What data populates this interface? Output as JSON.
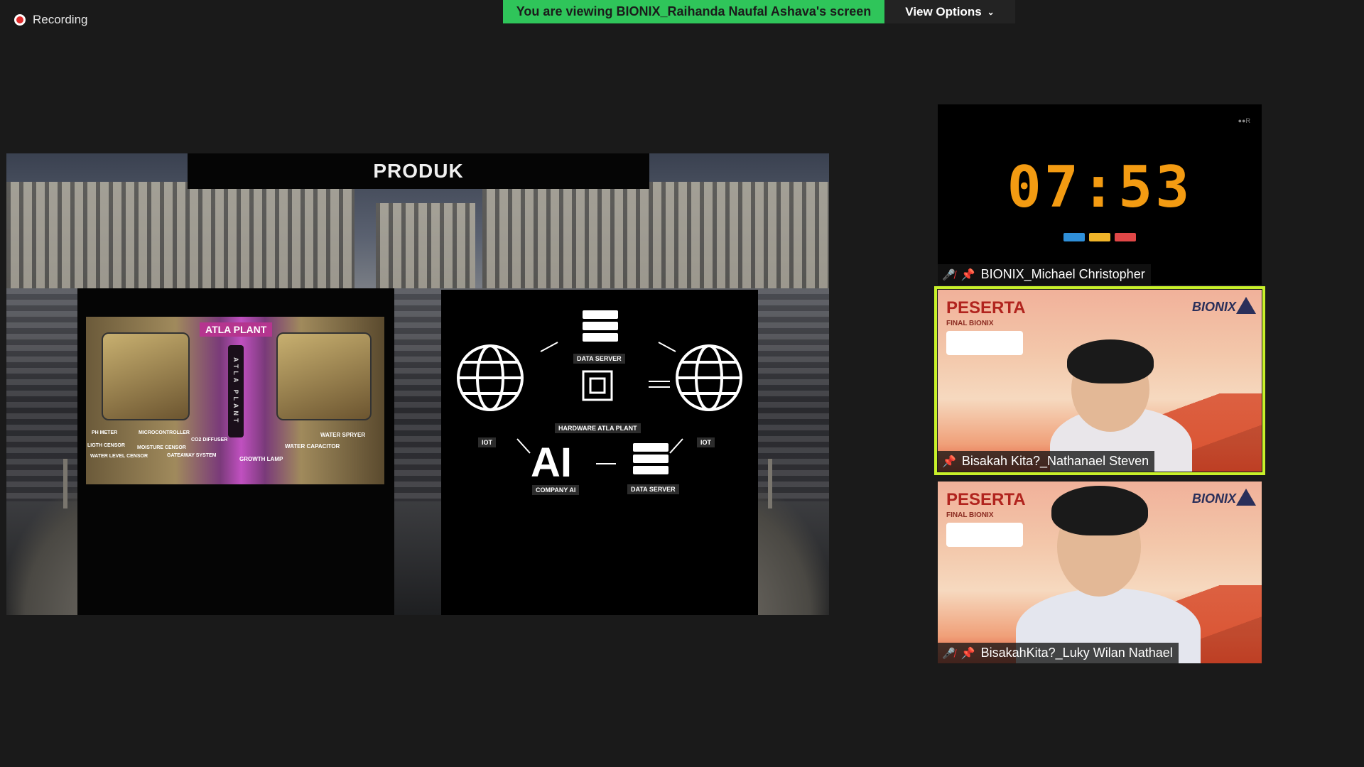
{
  "top_bar": {
    "recording_label": "Recording",
    "banner_text": "You are viewing BIONIX_Raihanda Naufal Ashava's screen",
    "view_options_label": "View Options",
    "banner_color": "#2fc55a"
  },
  "slide": {
    "title": "PRODUK",
    "left_panel": {
      "badge": "ATLA PLANT",
      "pillar_text": "ATLA PLANT",
      "labels": {
        "ph_meter": "PH METER",
        "light_censor": "LIGTH CENSOR",
        "water_level": "WATER LEVEL CENSOR",
        "moisture": "MOISTURE CENSOR",
        "microcontroller": "MICROCONTROLLER",
        "co2": "CO2 DIFFUSER",
        "gateway": "GATEAWAY SYSTEM",
        "growth_lamp": "GROWTH LAMP",
        "water_capacitor": "WATER CAPACITOR",
        "water_sprayer": "WATER SPRYER"
      }
    },
    "right_panel": {
      "ai_text": "AI",
      "labels": {
        "data_server_top": "DATA SERVER",
        "hardware": "HARDWARE ATLA PLANT",
        "iot_left": "IOT",
        "iot_right": "IOT",
        "company_ai": "COMPANY AI",
        "data_server_bottom": "DATA SERVER"
      }
    }
  },
  "participants": {
    "timer": {
      "display": "07:53",
      "corner": "●●R",
      "name": "BIONIX_Michael Christopher",
      "button_colors": [
        "#2f8fd8",
        "#f0b429",
        "#e04747"
      ]
    },
    "p1": {
      "banner_title": "PESERTA",
      "banner_sub": "FINAL BIONIX",
      "logo": "BIONIX",
      "name": "Bisakah Kita?_Nathanael Steven",
      "highlight_color": "#c8f02a"
    },
    "p2": {
      "banner_title": "PESERTA",
      "banner_sub": "FINAL BIONIX",
      "logo": "BIONIX",
      "name": "BisakahKita?_Luky Wilan Nathael"
    }
  }
}
